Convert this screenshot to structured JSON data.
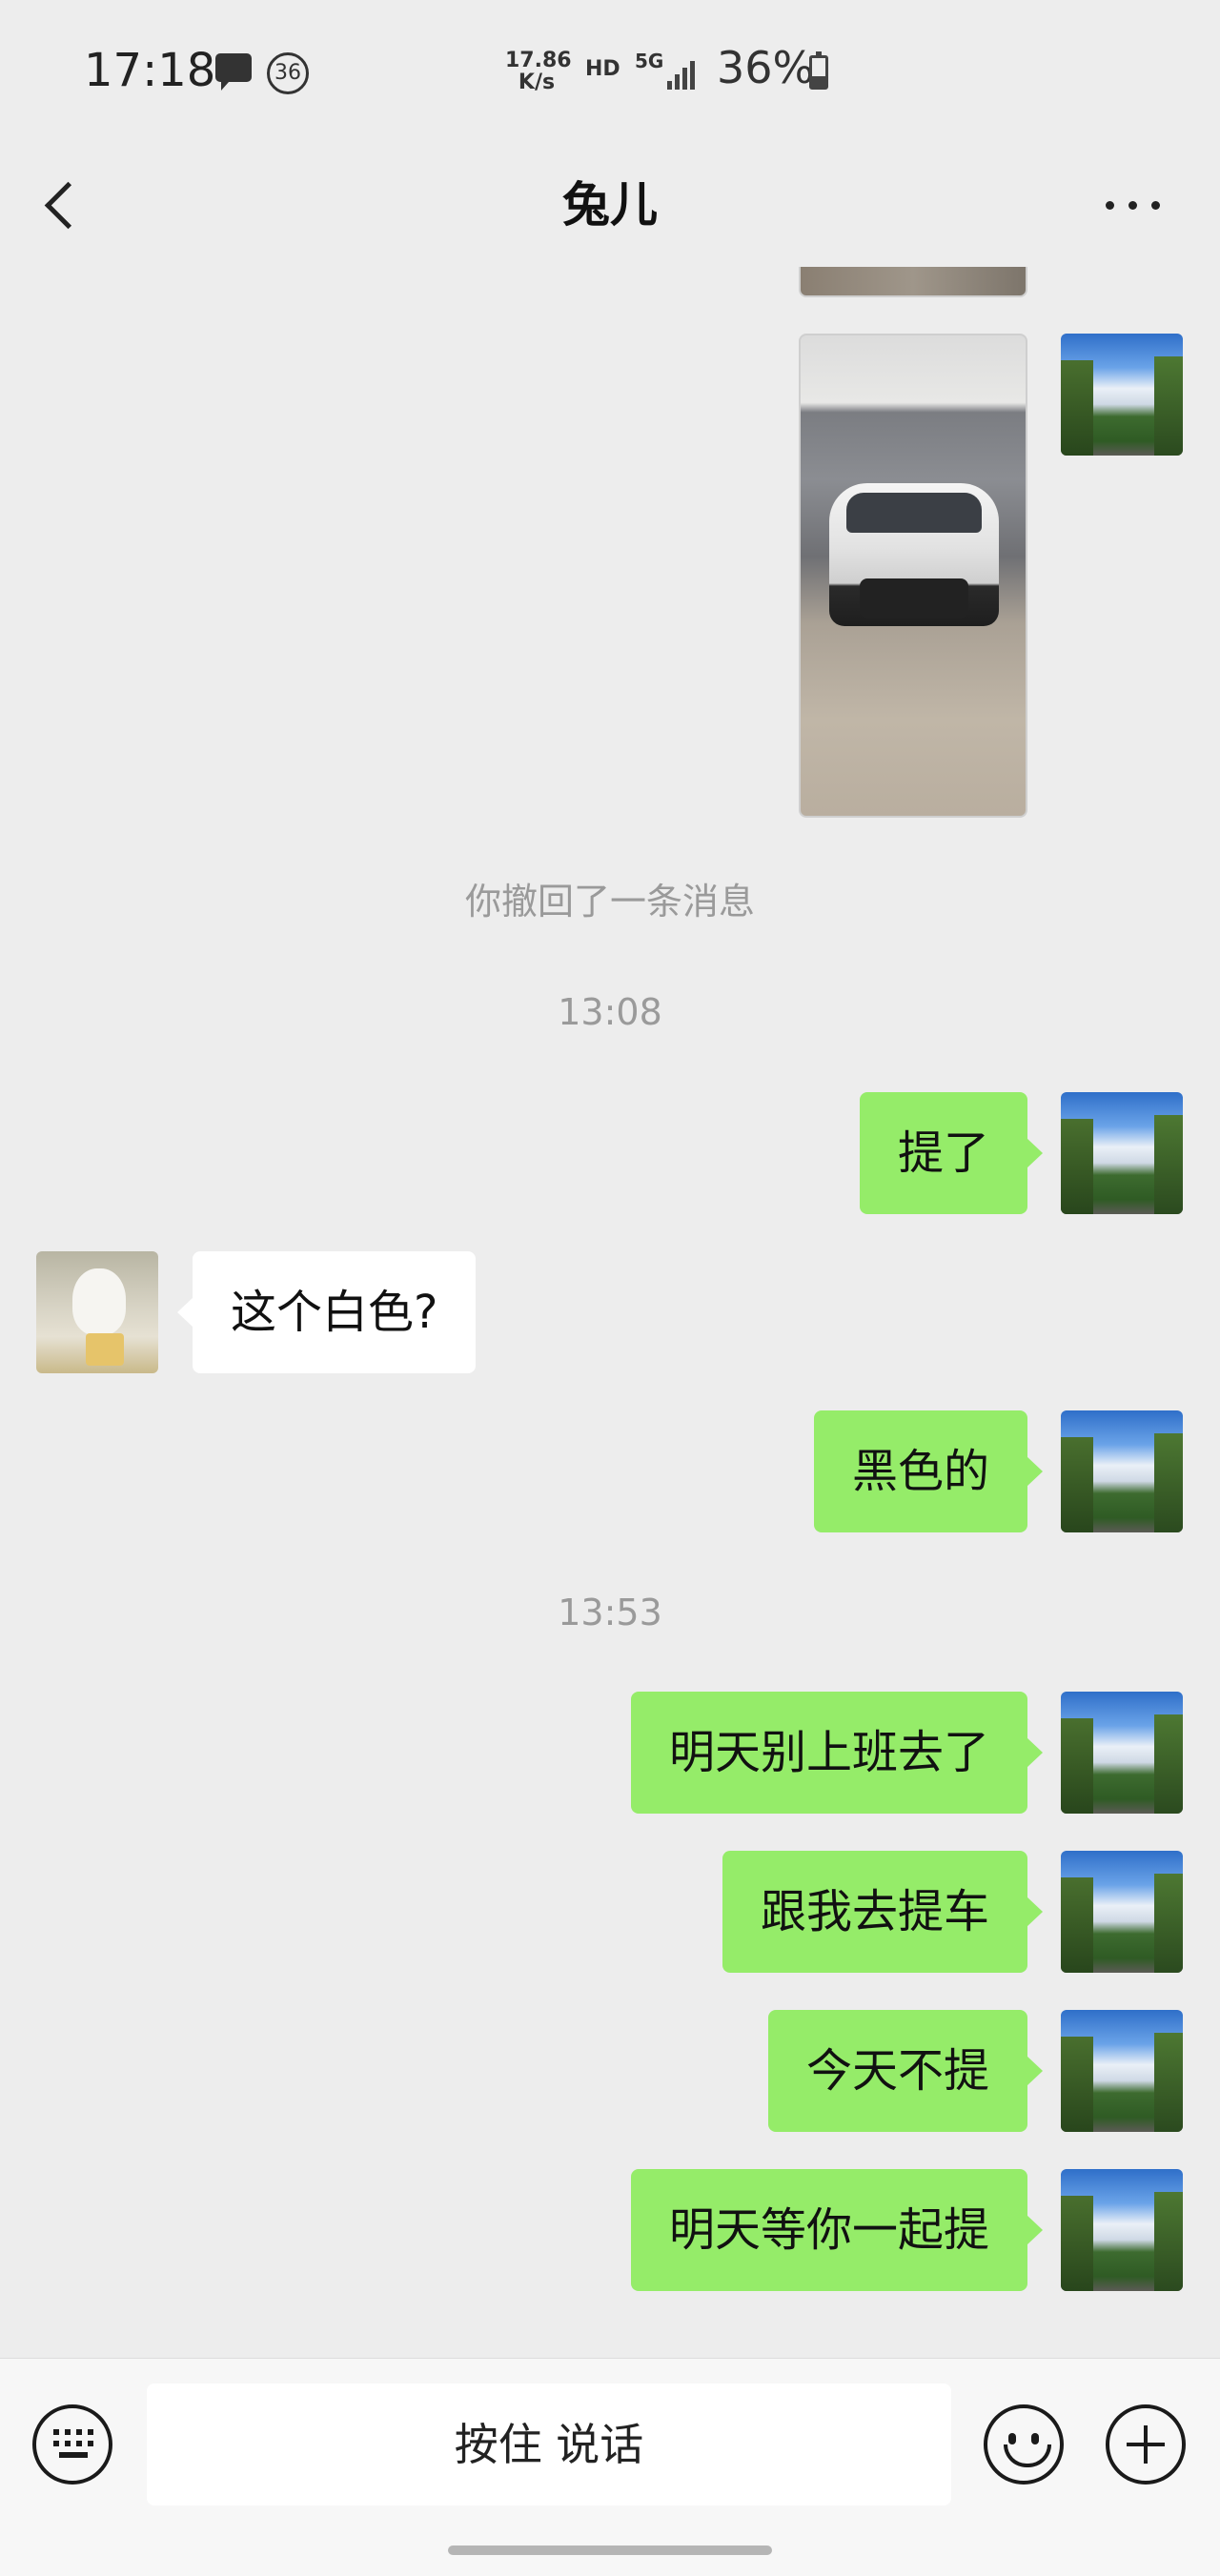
{
  "status_bar": {
    "time": "17:18",
    "notification_badge": "36",
    "net_speed_value": "17.86",
    "net_speed_unit": "K/s",
    "hd_label": "HD",
    "network_label": "5G",
    "battery_percent": "36%"
  },
  "header": {
    "title": "兔儿",
    "back_icon": "chevron-left-icon",
    "more_icon": "more-horizontal-icon"
  },
  "chat": {
    "recall_notice": "你撤回了一条消息",
    "timestamps": [
      "13:08",
      "13:53"
    ],
    "messages": [
      {
        "from": "me",
        "text": "提了"
      },
      {
        "from": "other",
        "text": "这个白色?"
      },
      {
        "from": "me",
        "text": "黑色的"
      },
      {
        "from": "me",
        "text": "明天别上班去了"
      },
      {
        "from": "me",
        "text": "跟我去提车"
      },
      {
        "from": "me",
        "text": "今天不提"
      },
      {
        "from": "me",
        "text": "明天等你一起提"
      }
    ]
  },
  "input_bar": {
    "voice_button_label": "按住 说话",
    "keyboard_icon": "keyboard-icon",
    "emoji_icon": "emoji-icon",
    "plus_icon": "plus-icon"
  },
  "colors": {
    "background": "#ededed",
    "my_bubble": "#95ec69",
    "other_bubble": "#ffffff",
    "system_text": "#9a9a9a"
  }
}
